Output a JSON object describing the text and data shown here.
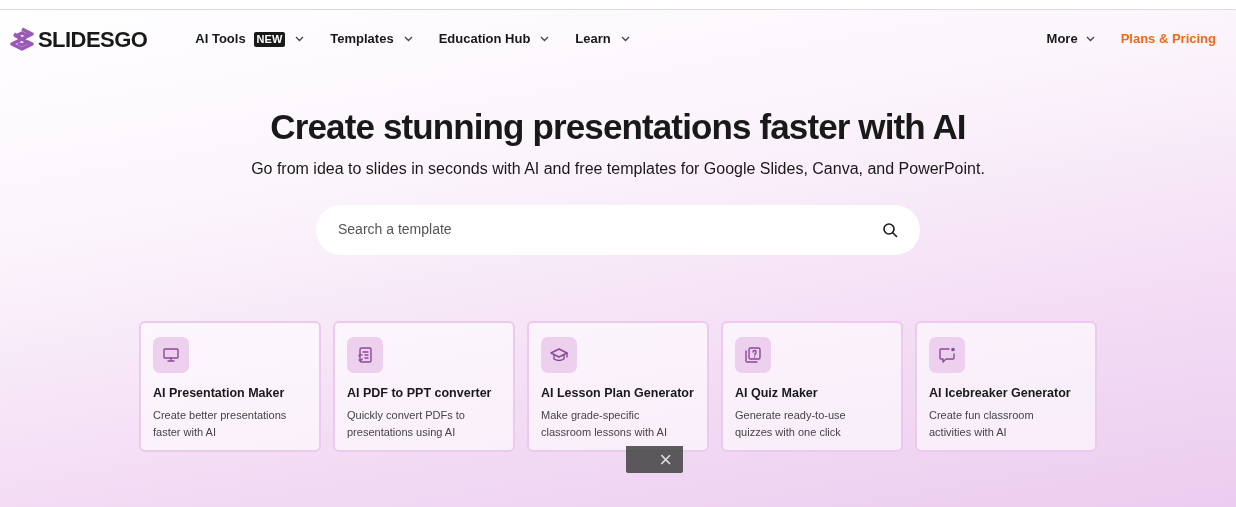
{
  "logo": {
    "text": "SLIDESGO"
  },
  "nav": [
    {
      "label": "AI Tools",
      "badge": "NEW",
      "dropdown": true
    },
    {
      "label": "Templates",
      "dropdown": true
    },
    {
      "label": "Education Hub",
      "dropdown": true
    },
    {
      "label": "Learn",
      "dropdown": true
    }
  ],
  "nav_right": [
    {
      "label": "More",
      "dropdown": true,
      "kind": "menu"
    },
    {
      "label": "Plans & Pricing",
      "dropdown": false,
      "kind": "link"
    }
  ],
  "hero": {
    "title": "Create stunning presentations faster with AI",
    "subtitle": "Go from idea to slides in seconds with AI and free templates for Google Slides, Canva, and PowerPoint."
  },
  "search": {
    "placeholder": "Search a template"
  },
  "tools": [
    {
      "kind": "monitor",
      "title": "AI Presentation Maker",
      "description": "Create better presentations faster with AI"
    },
    {
      "kind": "document",
      "title": "AI PDF to PPT converter",
      "description": "Quickly convert PDFs to presentations using AI"
    },
    {
      "kind": "cap",
      "title": "AI Lesson Plan Generator",
      "description": "Make grade-specific classroom lessons with AI"
    },
    {
      "kind": "quiz",
      "title": "AI Quiz Maker",
      "description": "Generate ready-to-use quizzes with one click"
    },
    {
      "kind": "chat",
      "title": "AI Icebreaker Generator",
      "description": "Create fun classroom activities with AI"
    }
  ],
  "overlay": {
    "close": "×"
  }
}
